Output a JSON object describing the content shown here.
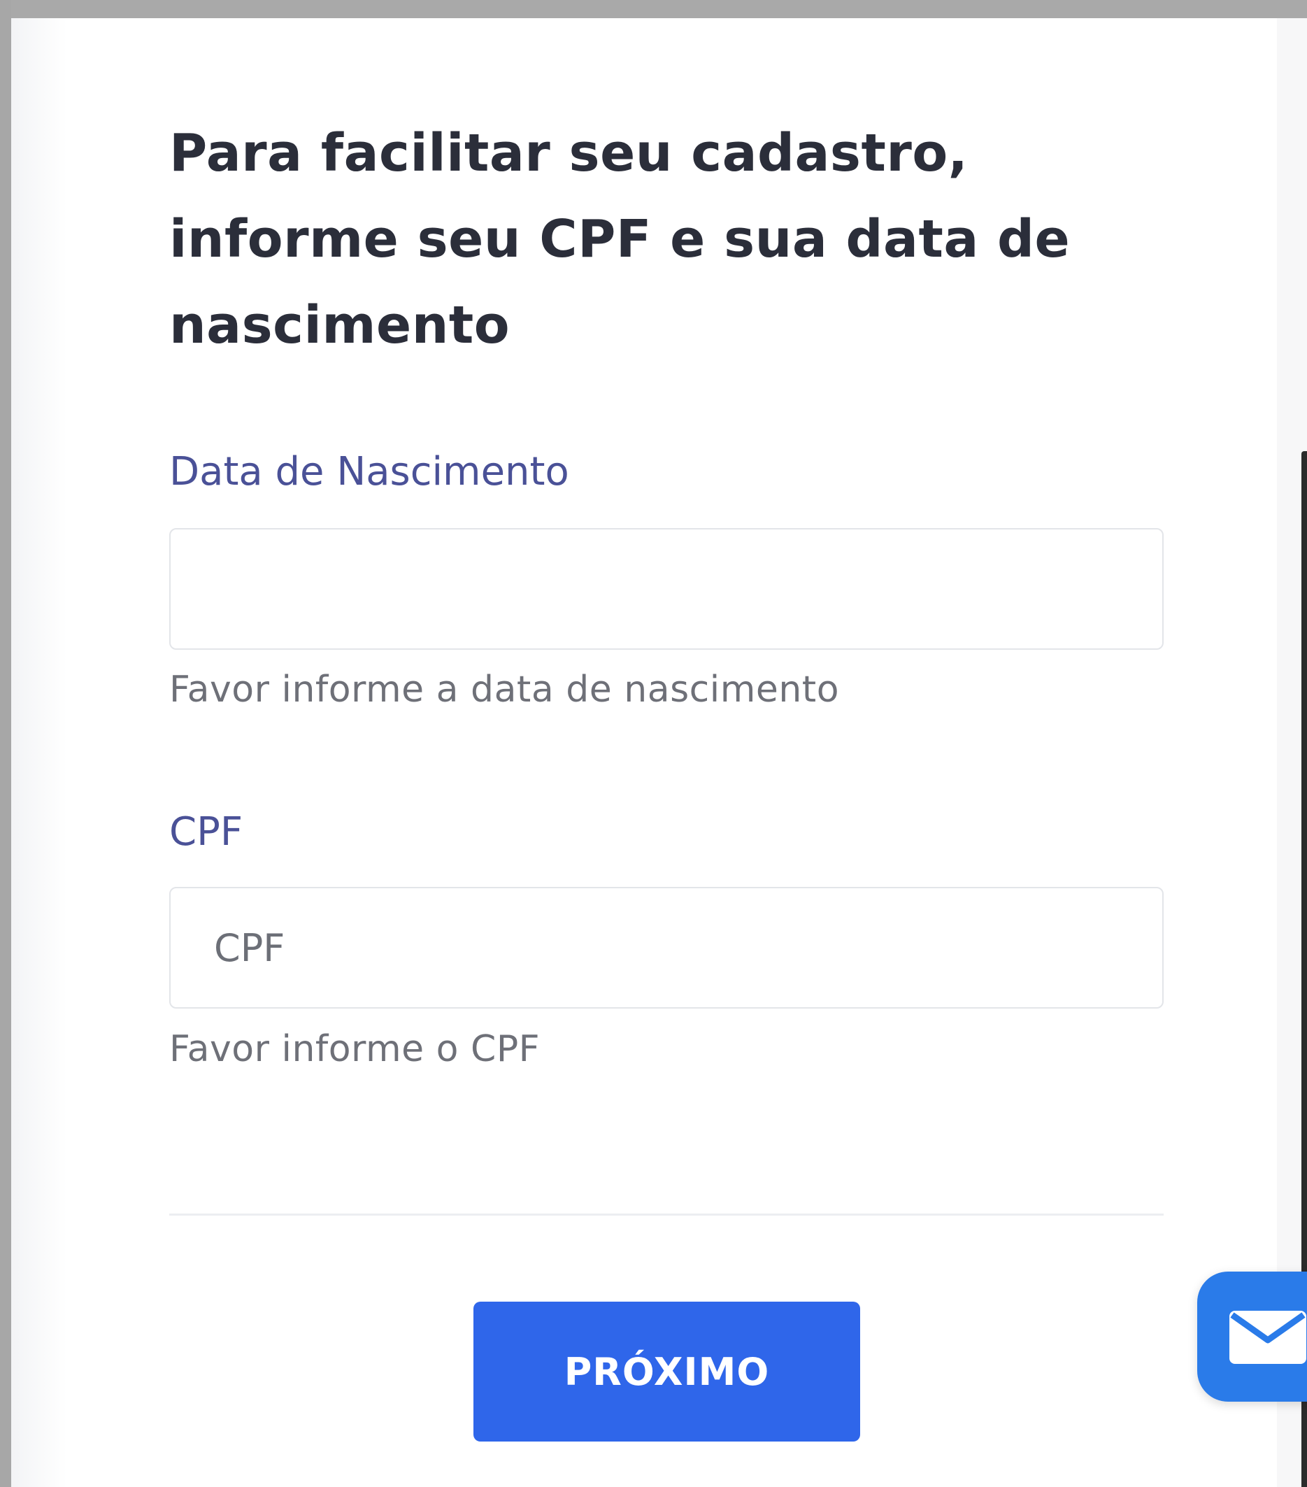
{
  "form": {
    "title": "Para facilitar seu cadastro, informe seu CPF e sua data de nascimento",
    "birth_date": {
      "label": "Data de Nascimento",
      "value": "",
      "placeholder": "",
      "help": "Favor informe a data de nascimento"
    },
    "cpf": {
      "label": "CPF",
      "value": "",
      "placeholder": "CPF",
      "help": "Favor informe o CPF"
    },
    "next_button": "PRÓXIMO"
  },
  "chat_widget": {
    "icon": "envelope-icon"
  }
}
